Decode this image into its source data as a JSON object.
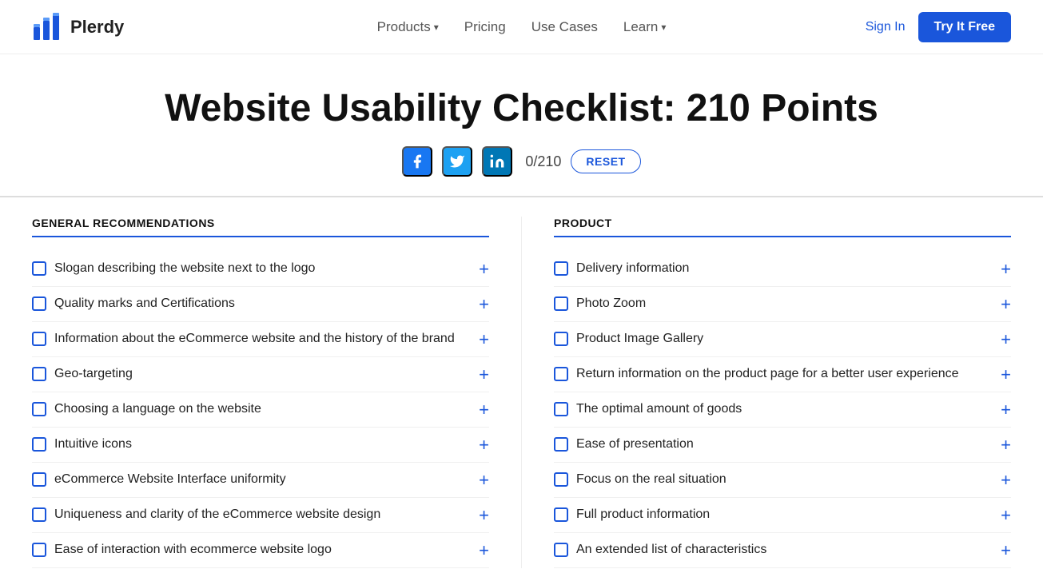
{
  "nav": {
    "logo_text": "Plerdy",
    "links": [
      {
        "label": "Products",
        "has_chevron": true
      },
      {
        "label": "Pricing",
        "has_chevron": false
      },
      {
        "label": "Use Cases",
        "has_chevron": false
      },
      {
        "label": "Learn",
        "has_chevron": true
      }
    ],
    "sign_in": "Sign In",
    "try_free": "Try It Free"
  },
  "hero": {
    "title": "Website Usability Checklist: 210 Points",
    "counter": "0/210",
    "reset": "RESET",
    "social": [
      {
        "name": "facebook",
        "icon": "f"
      },
      {
        "name": "twitter",
        "icon": "t"
      },
      {
        "name": "linkedin",
        "icon": "in"
      }
    ]
  },
  "sections": [
    {
      "id": "general",
      "title": "GENERAL RECOMMENDATIONS",
      "items": [
        "Slogan describing the website next to the logo",
        "Quality marks and Certifications",
        "Information about the eCommerce website and the history of the brand",
        "Geo-targeting",
        "Choosing a language on the website",
        "Intuitive icons",
        "eCommerce Website Interface uniformity",
        "Uniqueness and clarity of the eCommerce website design",
        "Ease of interaction with ecommerce website logo"
      ]
    },
    {
      "id": "product",
      "title": "PRODUCT",
      "items": [
        "Delivery information",
        "Photo Zoom",
        "Product Image Gallery",
        "Return information on the product page for a better user experience",
        "The optimal amount of goods",
        "Ease of presentation",
        "Focus on the real situation",
        "Full product information",
        "An extended list of characteristics"
      ]
    }
  ],
  "colors": {
    "blue": "#1a56db",
    "facebook": "#1877f2",
    "twitter": "#1da1f2",
    "linkedin": "#0077b5"
  }
}
